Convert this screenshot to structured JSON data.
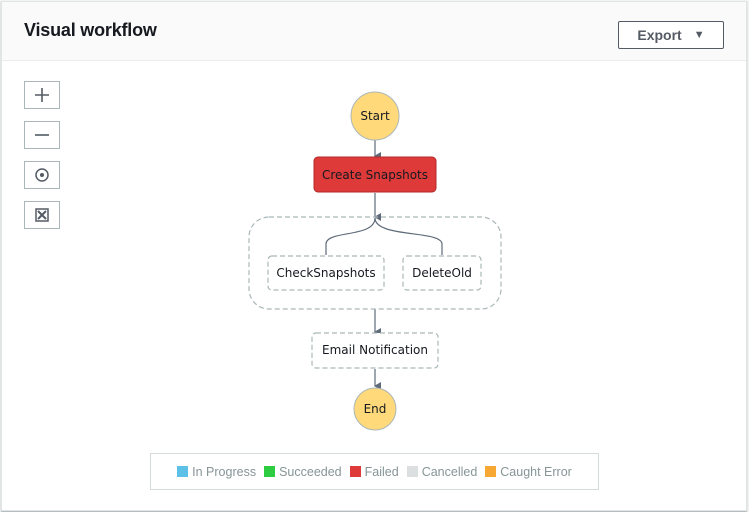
{
  "header": {
    "title": "Visual workflow",
    "export_label": "Export",
    "export_caret": "▼"
  },
  "zoom_controls": [
    {
      "name": "zoom-in",
      "icon": "plus-icon"
    },
    {
      "name": "zoom-out",
      "icon": "minus-icon"
    },
    {
      "name": "center",
      "icon": "target-icon"
    },
    {
      "name": "fit",
      "icon": "expand-icon"
    }
  ],
  "workflow": {
    "start": "Start",
    "end": "End",
    "states": {
      "create_snapshots": {
        "label": "Create Snapshots",
        "status": "Failed"
      },
      "check_snapshots": {
        "label": "CheckSnapshots",
        "status": "NotStarted"
      },
      "delete_old": {
        "label": "DeleteOld",
        "status": "NotStarted"
      },
      "email_notification": {
        "label": "Email Notification",
        "status": "NotStarted"
      }
    },
    "parallel_group": [
      "CheckSnapshots",
      "DeleteOld"
    ]
  },
  "colors": {
    "start_end_fill": "#ffd97a",
    "failed": "#de3a3a",
    "edge": "#5f6b7a"
  },
  "legend": [
    {
      "label": "In Progress",
      "color": "#5dc0e6"
    },
    {
      "label": "Succeeded",
      "color": "#2ecc40"
    },
    {
      "label": "Failed",
      "color": "#de3a3a"
    },
    {
      "label": "Cancelled",
      "color": "#dcdfe0"
    },
    {
      "label": "Caught Error",
      "color": "#f7a833"
    }
  ]
}
